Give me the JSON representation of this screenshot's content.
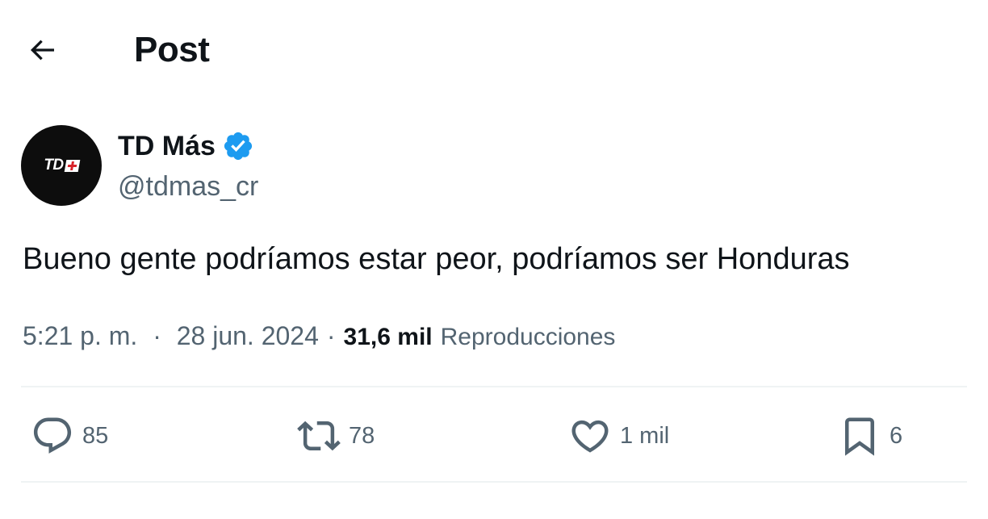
{
  "header": {
    "back_icon": "arrow-left-icon",
    "title": "Post"
  },
  "author": {
    "avatar_text": "TD",
    "display_name": "TD Más",
    "verified_icon": "verified-badge-icon",
    "verified_color": "#1d9bf0",
    "handle": "@tdmas_cr"
  },
  "post": {
    "text": "Bueno gente podríamos estar peor, podríamos ser Honduras",
    "time": "5:21 p. m.",
    "separator": "·",
    "date": "28 jun. 2024",
    "views_count": "31,6 mil",
    "views_label": "Reproducciones"
  },
  "actions": {
    "reply": {
      "icon": "reply-icon",
      "count": "85"
    },
    "repost": {
      "icon": "repost-icon",
      "count": "78"
    },
    "like": {
      "icon": "heart-icon",
      "count": "1 mil"
    },
    "bookmark": {
      "icon": "bookmark-icon",
      "count": "6"
    }
  },
  "colors": {
    "text_primary": "#0f1419",
    "text_secondary": "#536471",
    "divider": "#eff3f4",
    "accent": "#1d9bf0"
  }
}
